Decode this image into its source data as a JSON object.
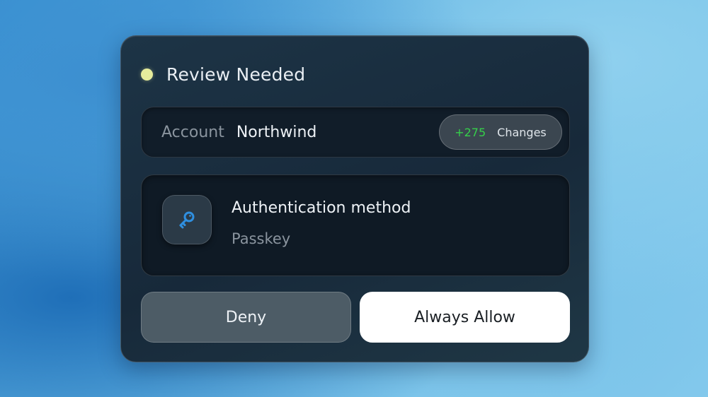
{
  "header": {
    "title": "Review Needed",
    "status_color": "#e6ec9c"
  },
  "account": {
    "label": "Account",
    "value": "Northwind",
    "changes_count": "+275",
    "changes_label": "Changes",
    "changes_color": "#35d04a"
  },
  "auth": {
    "icon": "key-icon",
    "title": "Authentication method",
    "value": "Passkey",
    "icon_color": "#2f8fe0"
  },
  "actions": {
    "deny_label": "Deny",
    "allow_label": "Always Allow"
  }
}
